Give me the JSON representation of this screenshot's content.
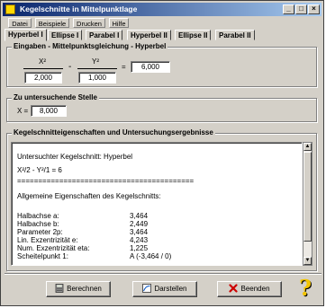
{
  "window": {
    "title": "Kegelschnitte in Mittelpunktlage"
  },
  "menu": [
    "Datei",
    "Beispiele",
    "Drucken",
    "Hilfe"
  ],
  "tabs": [
    "Hyperbel I",
    "Ellipse I",
    "Parabel I",
    "Hyperbel II",
    "Ellipse II",
    "Parabel II"
  ],
  "inputs": {
    "title": "Eingaben - Mittelpunktsgleichung - Hyperbel",
    "x_term": "X²",
    "y_term": "Y²",
    "minus": "-",
    "equals": "=",
    "denom_x": "2,000",
    "denom_y": "1,000",
    "rhs": "6,000"
  },
  "stelle": {
    "title": "Zu untersuchende Stelle",
    "label": "X =",
    "value": "8,000"
  },
  "results": {
    "title": "Kegelschnitteigenschaften und Untersuchungsergebnisse",
    "kegel_line": "Untersuchter Kegelschnitt: Hyperbel",
    "equation": "X²/2 - Y²/1 = 6",
    "separator": "==========================================",
    "section": "Allgemeine Eigenschaften des Kegelschnitts:",
    "rows": [
      {
        "label": "Halbachse a:",
        "value": "3,464"
      },
      {
        "label": "Halbachse b:",
        "value": "2,449"
      },
      {
        "label": "Parameter 2p:",
        "value": "3,464"
      },
      {
        "label": "Lin. Exzentrizität e:",
        "value": "4,243"
      },
      {
        "label": "Num. Exzentrizität eta:",
        "value": "1,225"
      },
      {
        "label": "Scheitelpunkt 1:",
        "value": "A (-3,464 / 0)"
      }
    ]
  },
  "buttons": {
    "berechnen": "Berechnen",
    "darstellen": "Darstellen",
    "beenden": "Beenden",
    "help": "?"
  },
  "colors": {
    "title_start": "#08246b",
    "title_end": "#a6caf0",
    "face": "#d4d0c8",
    "help": "#f2c400",
    "close_x": "#cc0000"
  }
}
